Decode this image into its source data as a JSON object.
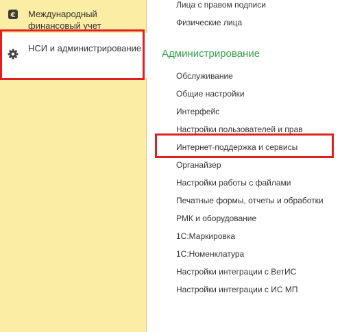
{
  "sidebar": {
    "items": [
      {
        "label": "Международный финансовый учет",
        "icon": "euro-icon"
      },
      {
        "label": "НСИ и администрирование",
        "icon": "gear-icon"
      }
    ]
  },
  "main": {
    "top_links": [
      "Лица с правом подписи",
      "Физические лица"
    ],
    "section_title": "Администрирование",
    "links": [
      "Обслуживание",
      "Общие настройки",
      "Интерфейс",
      "Настройки пользователей и прав",
      "Интернет-поддержка и сервисы",
      "Органайзер",
      "Настройки работы с файлами",
      "Печатные формы, отчеты и обработки",
      "РМК и оборудование",
      "1С:Маркировка",
      "1С:Номенклатура",
      "Настройки интеграции с ВетИС",
      "Настройки интеграции с ИС МП"
    ]
  },
  "colors": {
    "sidebar_bg": "#fbeda4",
    "section_title": "#2fa34a",
    "highlight_frame": "#e02020"
  }
}
